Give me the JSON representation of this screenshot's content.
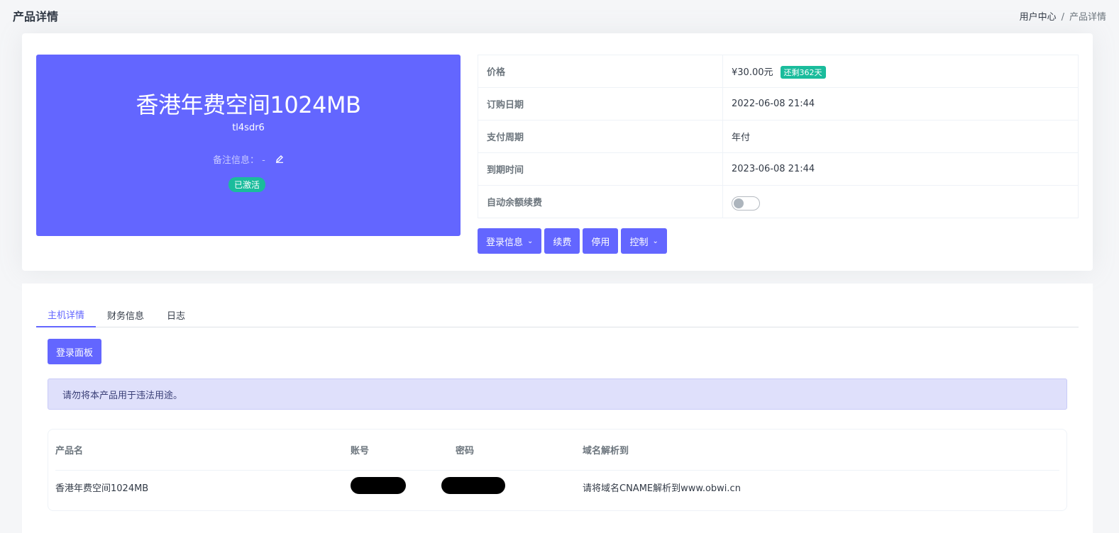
{
  "header": {
    "title": "产品详情",
    "breadcrumb": [
      "用户中心",
      "/",
      "产品详情"
    ]
  },
  "hero": {
    "product_name": "香港年费空间1024MB",
    "code": "tl4sdr6",
    "note_label": "备注信息：",
    "note_value": "-",
    "status": "已激活",
    "color": "#6366ff"
  },
  "info": {
    "price_label": "价格",
    "price_value": "¥30.00元",
    "remaining": "还剩362天",
    "order_date_label": "订购日期",
    "order_date_value": "2022-06-08 21:44",
    "cycle_label": "支付周期",
    "cycle_value": "年付",
    "expire_label": "到期时间",
    "expire_value": "2023-06-08 21:44",
    "auto_renew_label": "自动余额续费",
    "auto_renew_on": false
  },
  "actions": {
    "login_info": "登录信息",
    "renew": "续费",
    "disable": "停用",
    "control": "控制"
  },
  "tabs": [
    "主机详情",
    "财务信息",
    "日志"
  ],
  "panel_button": "登录面板",
  "alert": "请勿将本产品用于违法用途。",
  "table": {
    "headers": [
      "产品名",
      "账号",
      "密码",
      "域名解析到"
    ],
    "row": {
      "product": "香港年费空间1024MB",
      "dns": "请将域名CNAME解析到www.obwi.cn"
    }
  }
}
